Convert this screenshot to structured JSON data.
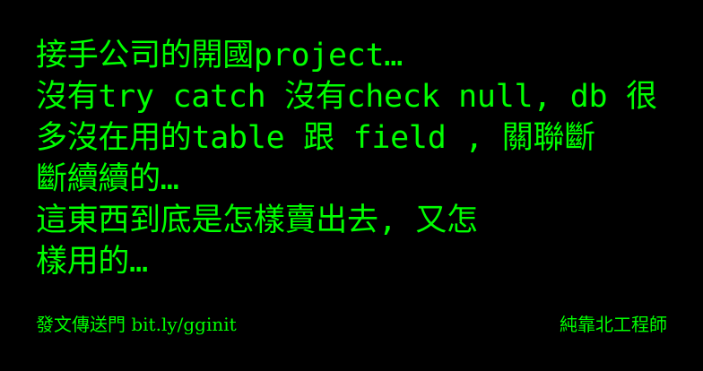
{
  "colors": {
    "background": "#000000",
    "text": "#00ff00"
  },
  "message": {
    "lines": [
      "接手公司的開國project…",
      "沒有try catch 沒有check null, db 很",
      "多沒在用的table 跟 field , 關聯斷",
      "斷續續的…",
      "這東西到底是怎樣賣出去, 又怎",
      "樣用的…"
    ]
  },
  "footer": {
    "link_text": "發文傳送門 bit.ly/gginit",
    "signature": "純靠北工程師"
  }
}
